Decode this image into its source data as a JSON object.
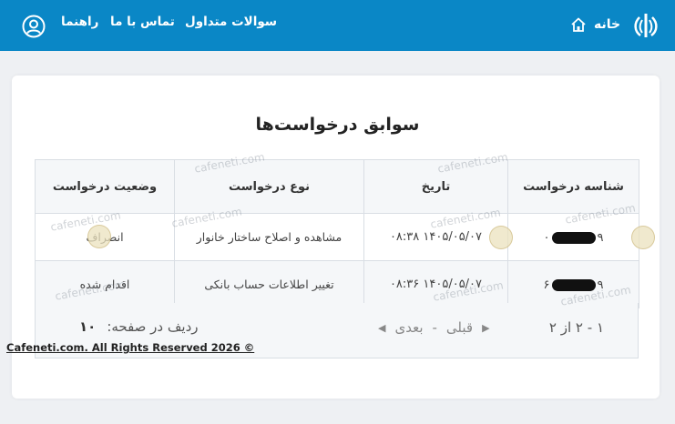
{
  "header": {
    "home_label": "خانه",
    "nav": {
      "faq": "سوالات متداول",
      "contact": "تماس با ما",
      "guide": "راهنما"
    }
  },
  "page": {
    "title": "سوابق درخواست‌ها"
  },
  "table": {
    "headers": {
      "id": "شناسه درخواست",
      "date": "تاریخ",
      "type": "نوع درخواست",
      "status": "وضعیت درخواست"
    },
    "rows": [
      {
        "id_prefix": "۹",
        "id_suffix": "۰",
        "date": "۱۴۰۵/۰۵/۰۷ ۰۸:۳۸",
        "type": "مشاهده و اصلاح ساختار خانوار",
        "status": "انصراف"
      },
      {
        "id_prefix": "۹",
        "id_suffix": "۶",
        "date": "۱۴۰۵/۰۵/۰۷ ۰۸:۳۶",
        "type": "تغییر اطلاعات حساب بانکی",
        "status": "اقدام شده"
      }
    ]
  },
  "pagination": {
    "range": "۱ - ۲ از ۲",
    "previous": "قبلی",
    "next": "بعدی",
    "separator": "-",
    "rows_label": "ردیف در صفحه:",
    "rows_per_page": "۱۰"
  },
  "watermark": {
    "text": "cafeneti.com"
  },
  "footer": {
    "copyright": "Cafeneti.com. All Rights Reserved 2026 ©"
  },
  "colors": {
    "header_bg": "#0a87c6",
    "page_bg": "#eef0f3"
  },
  "icons": {
    "emblem": "iran-emblem-icon",
    "home": "home-icon",
    "avatar": "user-circle-icon"
  }
}
